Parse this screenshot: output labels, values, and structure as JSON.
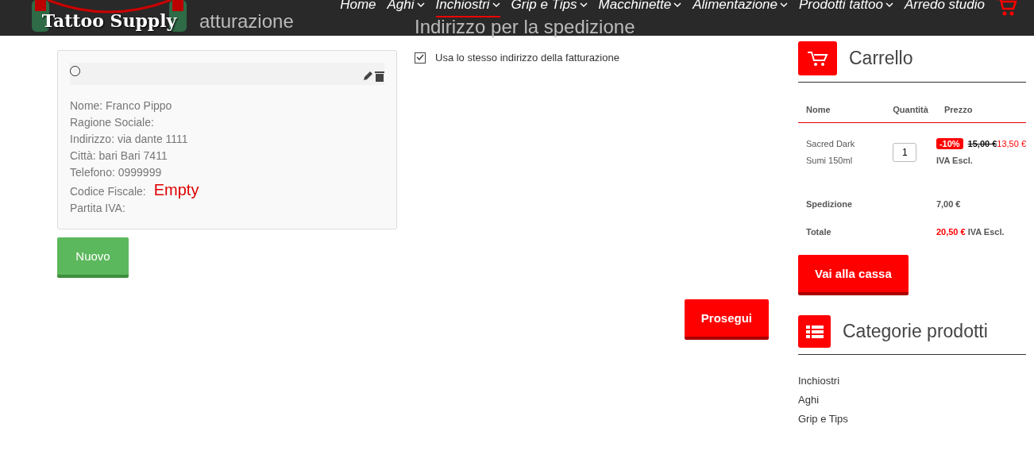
{
  "header": {
    "logo": "Tattoo Supply",
    "nav": [
      {
        "label": "Home",
        "dropdown": false,
        "selected": false
      },
      {
        "label": "Aghi",
        "dropdown": true,
        "selected": false
      },
      {
        "label": "Inchiostri",
        "dropdown": true,
        "selected": true
      },
      {
        "label": "Grip e Tips",
        "dropdown": true,
        "selected": false
      },
      {
        "label": "Macchinette",
        "dropdown": true,
        "selected": false
      },
      {
        "label": "Alimentazione",
        "dropdown": true,
        "selected": false
      },
      {
        "label": "Prodotti tattoo",
        "dropdown": true,
        "selected": false
      },
      {
        "label": "Arredo studio",
        "dropdown": false,
        "selected": false
      }
    ]
  },
  "billing": {
    "heading": "atturazione",
    "address": {
      "selected": false,
      "lines": [
        {
          "label": "Nome:",
          "value": "Franco Pippo"
        },
        {
          "label": "Ragione Sociale:"
        },
        {
          "label": "Indirizzo:",
          "value": "via dante 1111"
        },
        {
          "label": "Città:",
          "value": "bari Bari 7411"
        },
        {
          "label": "Telefono:",
          "value": "0999999"
        },
        {
          "label": "Codice Fiscale:",
          "warning": "Empty"
        },
        {
          "label": "Partita IVA:"
        }
      ]
    },
    "new_button": "Nuovo"
  },
  "shipping": {
    "heading": "Indirizzo per la spedizione",
    "same_as_billing": {
      "label": "Usa lo stesso indirizzo della fatturazione",
      "checked": true
    },
    "continue_button": "Prosegui"
  },
  "cart": {
    "title": "Carrello",
    "columns": [
      "Nome",
      "Quantità",
      "Prezzo"
    ],
    "items": [
      {
        "name": "Sacred Dark Sumi 150ml",
        "quantity": "1",
        "discount": "-10%",
        "old_price": "15,00 €",
        "price": "13,50 €",
        "tax": "IVA Escl."
      }
    ],
    "shipping_label": "Spedizione",
    "shipping_value": "7,00 €",
    "total_label": "Totale",
    "total_value": "20,50 €",
    "total_tax": "IVA Escl.",
    "checkout_button": "Vai alla cassa"
  },
  "categories": {
    "title": "Categorie prodotti",
    "items": [
      "Inchiostri",
      "Aghi",
      "Grip e Tips"
    ]
  }
}
